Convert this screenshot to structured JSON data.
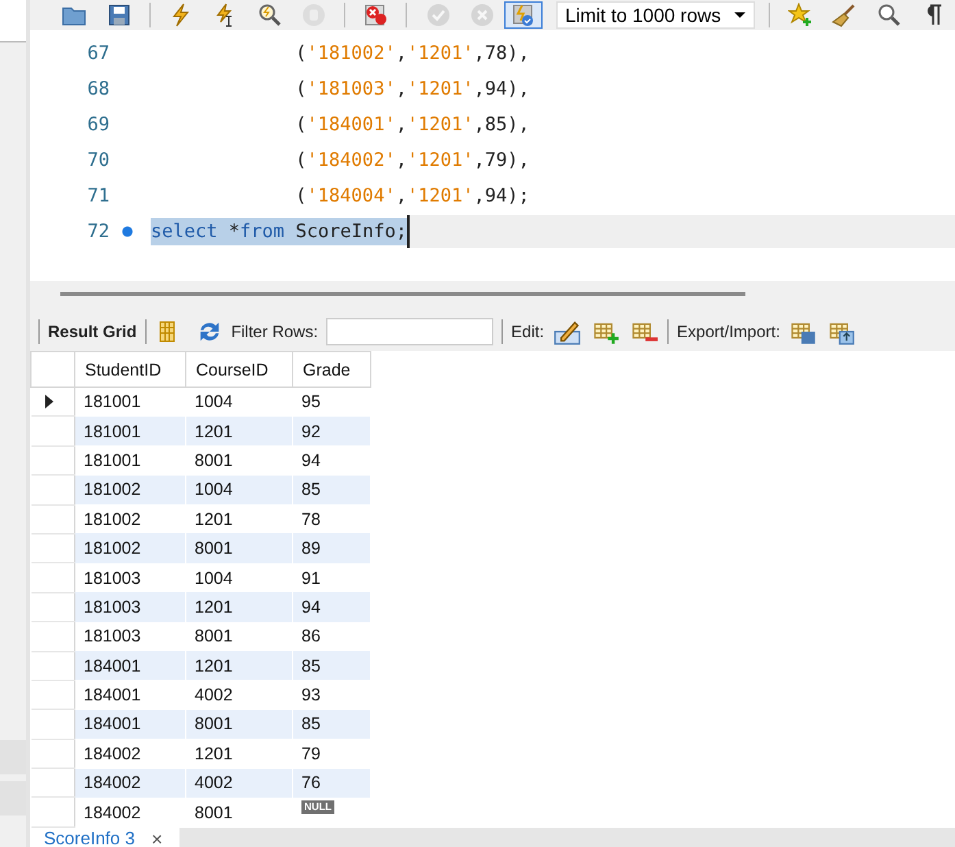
{
  "toolbar": {
    "buttons": [
      {
        "kind": "folder",
        "disabled": false,
        "selected": false
      },
      {
        "kind": "save",
        "disabled": false,
        "selected": false
      },
      {
        "kind": "separator"
      },
      {
        "kind": "bolt",
        "disabled": false,
        "selected": false
      },
      {
        "kind": "bolt-cursor",
        "disabled": false,
        "selected": false
      },
      {
        "kind": "magnifier-bolt",
        "disabled": false,
        "selected": false
      },
      {
        "kind": "stop",
        "disabled": true,
        "selected": false
      },
      {
        "kind": "separator"
      },
      {
        "kind": "error-stop",
        "disabled": false,
        "selected": false
      },
      {
        "kind": "separator"
      },
      {
        "kind": "check",
        "disabled": true,
        "selected": false
      },
      {
        "kind": "cancel",
        "disabled": true,
        "selected": false
      },
      {
        "kind": "toggle",
        "disabled": false,
        "selected": true
      },
      {
        "kind": "limit",
        "value": "Limit to 1000 rows"
      },
      {
        "kind": "separator"
      },
      {
        "kind": "star",
        "disabled": false,
        "selected": false
      },
      {
        "kind": "broom",
        "disabled": false,
        "selected": false
      },
      {
        "kind": "find",
        "disabled": false,
        "selected": false
      },
      {
        "kind": "pilcrow",
        "disabled": false,
        "selected": false
      }
    ]
  },
  "editor": {
    "lines": [
      {
        "number": "67",
        "marker": false,
        "selected": false,
        "tokens": [
          {
            "kind": "punct",
            "text": "             ("
          },
          {
            "kind": "string",
            "text": "'181002'"
          },
          {
            "kind": "punct",
            "text": ","
          },
          {
            "kind": "string",
            "text": "'1201'"
          },
          {
            "kind": "punct",
            "text": ",78),"
          }
        ]
      },
      {
        "number": "68",
        "marker": false,
        "selected": false,
        "tokens": [
          {
            "kind": "punct",
            "text": "             ("
          },
          {
            "kind": "string",
            "text": "'181003'"
          },
          {
            "kind": "punct",
            "text": ","
          },
          {
            "kind": "string",
            "text": "'1201'"
          },
          {
            "kind": "punct",
            "text": ",94),"
          }
        ]
      },
      {
        "number": "69",
        "marker": false,
        "selected": false,
        "tokens": [
          {
            "kind": "punct",
            "text": "             ("
          },
          {
            "kind": "string",
            "text": "'184001'"
          },
          {
            "kind": "punct",
            "text": ","
          },
          {
            "kind": "string",
            "text": "'1201'"
          },
          {
            "kind": "punct",
            "text": ",85),"
          }
        ]
      },
      {
        "number": "70",
        "marker": false,
        "selected": false,
        "tokens": [
          {
            "kind": "punct",
            "text": "             ("
          },
          {
            "kind": "string",
            "text": "'184002'"
          },
          {
            "kind": "punct",
            "text": ","
          },
          {
            "kind": "string",
            "text": "'1201'"
          },
          {
            "kind": "punct",
            "text": ",79),"
          }
        ]
      },
      {
        "number": "71",
        "marker": false,
        "selected": false,
        "tokens": [
          {
            "kind": "punct",
            "text": "             ("
          },
          {
            "kind": "string",
            "text": "'184004'"
          },
          {
            "kind": "punct",
            "text": ","
          },
          {
            "kind": "string",
            "text": "'1201'"
          },
          {
            "kind": "punct",
            "text": ",94);"
          }
        ]
      },
      {
        "number": "72",
        "marker": true,
        "selected": true,
        "tokens": [
          {
            "kind": "keyword",
            "text": "select"
          },
          {
            "kind": "punct",
            "text": " *"
          },
          {
            "kind": "keyword",
            "text": "from"
          },
          {
            "kind": "punct",
            "text": " ScoreInfo;"
          }
        ]
      }
    ]
  },
  "result_toolbar": {
    "view": "Result Grid",
    "filter_label": "Filter Rows:",
    "edit_label": "Edit:",
    "export_label": "Export/Import:"
  },
  "grid": {
    "columns": [
      "StudentID",
      "CourseID",
      "Grade"
    ],
    "rows": [
      {
        "current": true,
        "cells": [
          "181001",
          "1004",
          "95"
        ]
      },
      {
        "current": false,
        "cells": [
          "181001",
          "1201",
          "92"
        ]
      },
      {
        "current": false,
        "cells": [
          "181001",
          "8001",
          "94"
        ]
      },
      {
        "current": false,
        "cells": [
          "181002",
          "1004",
          "85"
        ]
      },
      {
        "current": false,
        "cells": [
          "181002",
          "1201",
          "78"
        ]
      },
      {
        "current": false,
        "cells": [
          "181002",
          "8001",
          "89"
        ]
      },
      {
        "current": false,
        "cells": [
          "181003",
          "1004",
          "91"
        ]
      },
      {
        "current": false,
        "cells": [
          "181003",
          "1201",
          "94"
        ]
      },
      {
        "current": false,
        "cells": [
          "181003",
          "8001",
          "86"
        ]
      },
      {
        "current": false,
        "cells": [
          "184001",
          "1201",
          "85"
        ]
      },
      {
        "current": false,
        "cells": [
          "184001",
          "4002",
          "93"
        ]
      },
      {
        "current": false,
        "cells": [
          "184001",
          "8001",
          "85"
        ]
      },
      {
        "current": false,
        "cells": [
          "184002",
          "1201",
          "79"
        ]
      },
      {
        "current": false,
        "cells": [
          "184002",
          "4002",
          "76"
        ]
      },
      {
        "current": false,
        "cells": [
          "184002",
          "8001",
          "NULL"
        ],
        "null_last": true
      }
    ]
  },
  "tabs": [
    {
      "label": "ScoreInfo 3",
      "close": "×",
      "selected": true
    }
  ]
}
